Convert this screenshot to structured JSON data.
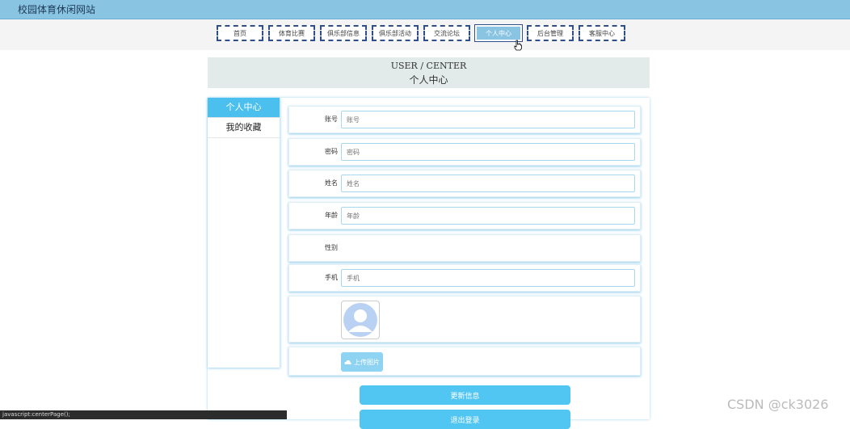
{
  "header": {
    "site_title": "校园体育休闲网站"
  },
  "nav": {
    "items": [
      "首页",
      "体育比赛",
      "俱乐部信息",
      "俱乐部活动",
      "交流论坛",
      "个人中心",
      "后台管理",
      "客服中心"
    ],
    "active_index": 5
  },
  "banner": {
    "en": "USER / CENTER",
    "cn": "个人中心"
  },
  "sidebar": {
    "items": [
      "个人中心",
      "我的收藏"
    ],
    "active_index": 0
  },
  "form": {
    "account": {
      "label": "账号",
      "placeholder": "账号"
    },
    "password": {
      "label": "密码",
      "placeholder": "密码"
    },
    "name": {
      "label": "姓名",
      "placeholder": "姓名"
    },
    "age": {
      "label": "年龄",
      "placeholder": "年龄"
    },
    "gender": {
      "label": "性别"
    },
    "phone": {
      "label": "手机",
      "placeholder": "手机"
    },
    "upload_label": "上传图片",
    "update_button": "更新信息",
    "logout_button": "退出登录"
  },
  "statusbar": {
    "text": "javascript:centerPage();"
  },
  "watermark": "CSDN @ck3026",
  "colors": {
    "topbar": "#8ac4e3",
    "accent": "#4bc0ee",
    "nav_border": "#2f4f8a"
  }
}
